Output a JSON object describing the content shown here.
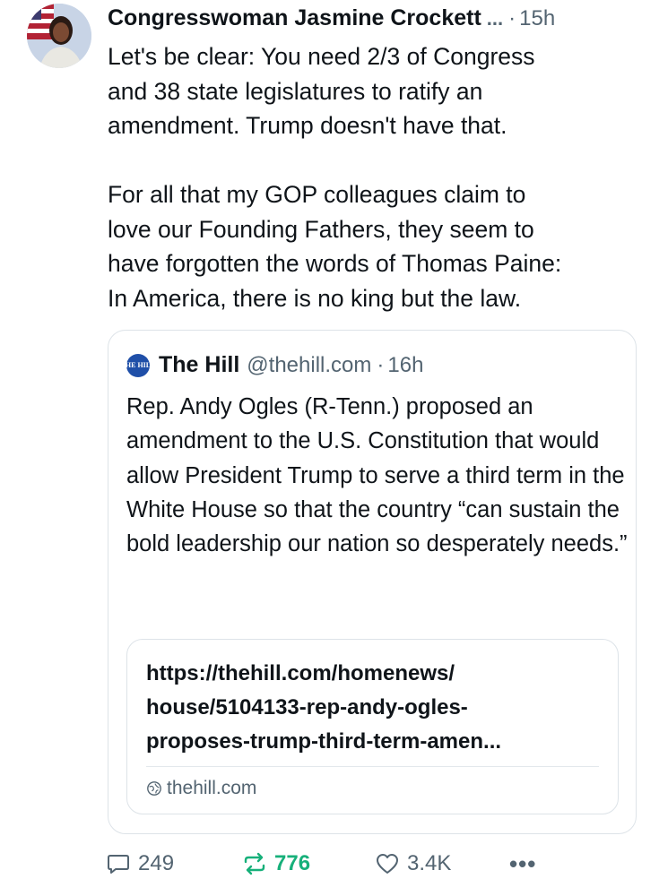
{
  "post": {
    "author": "Congresswoman Jasmine Crockett",
    "ellipsis": "...",
    "separator": "·",
    "time": "15h",
    "text": "Let's be clear: You need 2/3 of Congress\nand 38 state legislatures to ratify an\namendment. Trump doesn't have that.\n\nFor all that my GOP colleagues claim to\nlove our Founding Fathers, they seem to\nhave forgotten the words of Thomas Paine:\nIn America, there is no king but the law."
  },
  "quote": {
    "logo_text": "THE HILL",
    "name": "The Hill",
    "handle": "@thehill.com",
    "separator": "·",
    "time": "16h",
    "text": "Rep. Andy Ogles (R-Tenn.) proposed an amendment to the U.S. Constitution that would allow President Trump to serve a third term in the White House so that the country “can sustain the bold leadership our nation so desperately needs.”",
    "link": {
      "url": "https://thehill.com/homenews/\nhouse/5104133-rep-andy-ogles-\nproposes-trump-third-term-amen...",
      "domain": "thehill.com",
      "domain_icon": "globe-icon"
    }
  },
  "actions": {
    "replies": "249",
    "reposts": "776",
    "likes": "3.4K",
    "more": "•••",
    "repost_color": "#17b07a"
  },
  "colors": {
    "text": "#0f1419",
    "secondary": "#536471",
    "border": "#dde3e8"
  }
}
